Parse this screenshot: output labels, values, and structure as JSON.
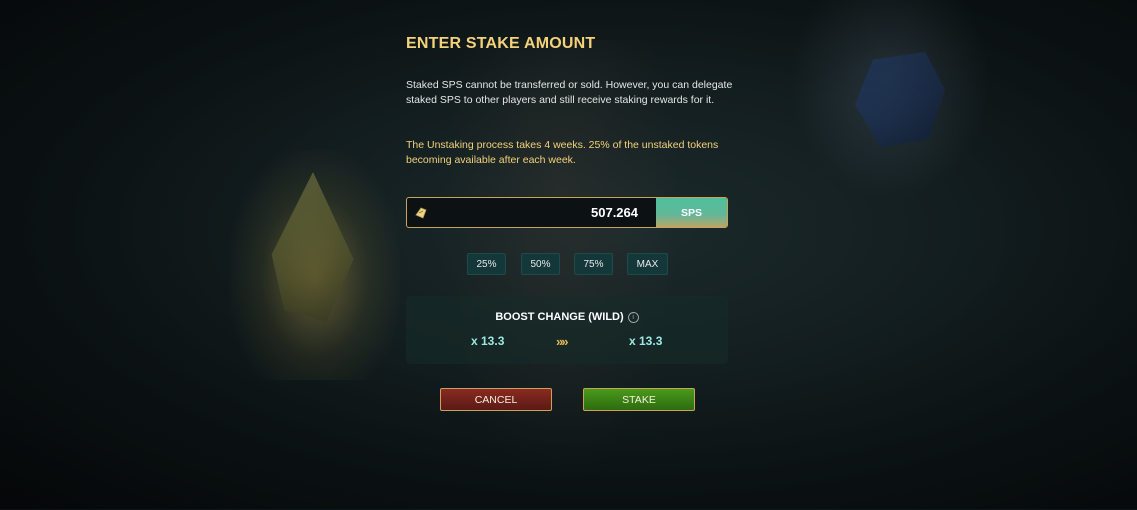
{
  "modal": {
    "title": "ENTER STAKE AMOUNT",
    "description": "Staked SPS cannot be transferred or sold. However, you can delegate staked SPS to other players and still receive staking rewards for it.",
    "warning": "The Unstaking process takes 4 weeks. 25% of the unstaked tokens becoming available after each week."
  },
  "amount": {
    "value": "507.264",
    "currency": "SPS",
    "icon": "sps-token-icon"
  },
  "percent_buttons": [
    "25%",
    "50%",
    "75%",
    "MAX"
  ],
  "boost": {
    "title": "BOOST CHANGE (WILD)",
    "info_icon": "i",
    "current": "x 13.3",
    "new": "x 13.3",
    "arrows": "»»"
  },
  "actions": {
    "cancel_label": "CANCEL",
    "stake_label": "STAKE"
  },
  "colors": {
    "title": "#f3d27a",
    "warning": "#f3d27a",
    "boost_value": "#9ee8e0",
    "cancel": "#8a2a22",
    "stake": "#4a9a1c",
    "border": "#c7a45a"
  }
}
